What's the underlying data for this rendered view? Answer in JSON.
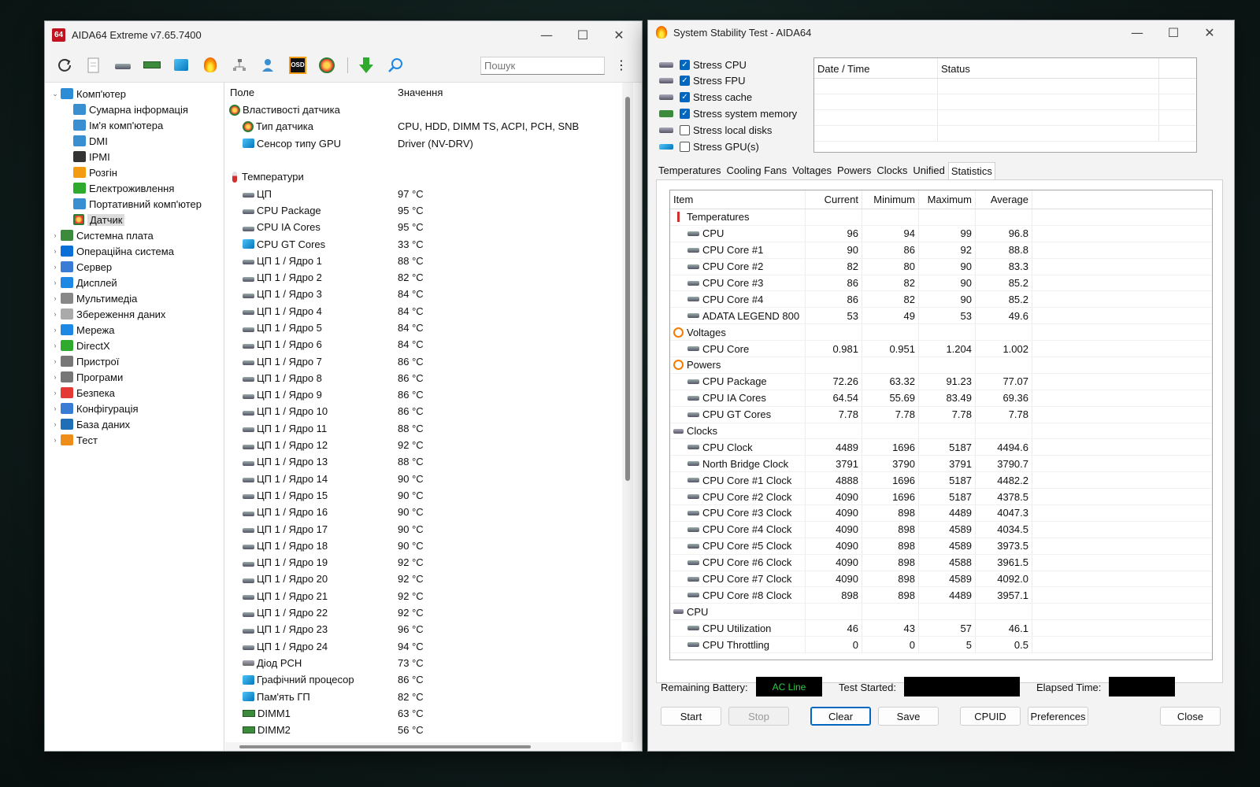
{
  "aida": {
    "title": "AIDA64 Extreme v7.65.7400",
    "badge": "64",
    "search_placeholder": "Пошук",
    "tree": [
      {
        "label": "Комп'ютер",
        "expanded": true,
        "icon": "computer-icon",
        "children": [
          {
            "label": "Сумарна інформація"
          },
          {
            "label": "Ім'я комп'ютера"
          },
          {
            "label": "DMI"
          },
          {
            "label": "IPMI"
          },
          {
            "label": "Розгін"
          },
          {
            "label": "Електроживлення"
          },
          {
            "label": "Портативний комп'ютер"
          },
          {
            "label": "Датчик",
            "selected": true
          }
        ]
      },
      {
        "label": "Системна плата"
      },
      {
        "label": "Операційна система"
      },
      {
        "label": "Сервер"
      },
      {
        "label": "Дисплей"
      },
      {
        "label": "Мультимедіа"
      },
      {
        "label": "Збереження даних"
      },
      {
        "label": "Мережа"
      },
      {
        "label": "DirectX"
      },
      {
        "label": "Пристрої"
      },
      {
        "label": "Програми"
      },
      {
        "label": "Безпека"
      },
      {
        "label": "Конфігурація"
      },
      {
        "label": "База даних"
      },
      {
        "label": "Тест"
      }
    ],
    "columns": {
      "field": "Поле",
      "value": "Значення"
    },
    "rows": [
      {
        "type": "group",
        "icon": "sensor",
        "field": "Властивості датчика",
        "value": ""
      },
      {
        "type": "item",
        "icon": "sensor",
        "field": "Тип датчика",
        "value": "CPU, HDD, DIMM TS, ACPI, PCH, SNB"
      },
      {
        "type": "item",
        "icon": "mon",
        "field": "Сенсор типу GPU",
        "value": "Driver  (NV-DRV)"
      },
      {
        "type": "blank",
        "field": "",
        "value": ""
      },
      {
        "type": "group",
        "icon": "therm",
        "field": "Температури",
        "value": ""
      },
      {
        "type": "item",
        "icon": "chip",
        "field": "ЦП",
        "value": "97 °C"
      },
      {
        "type": "item",
        "icon": "chip",
        "field": "CPU Package",
        "value": "95 °C"
      },
      {
        "type": "item",
        "icon": "chip",
        "field": "CPU IA Cores",
        "value": "95 °C"
      },
      {
        "type": "item",
        "icon": "mon",
        "field": "CPU GT Cores",
        "value": "33 °C"
      },
      {
        "type": "item",
        "icon": "chip",
        "field": "ЦП 1 / Ядро 1",
        "value": "88 °C"
      },
      {
        "type": "item",
        "icon": "chip",
        "field": "ЦП 1 / Ядро 2",
        "value": "82 °C"
      },
      {
        "type": "item",
        "icon": "chip",
        "field": "ЦП 1 / Ядро 3",
        "value": "84 °C"
      },
      {
        "type": "item",
        "icon": "chip",
        "field": "ЦП 1 / Ядро 4",
        "value": "84 °C"
      },
      {
        "type": "item",
        "icon": "chip",
        "field": "ЦП 1 / Ядро 5",
        "value": "84 °C"
      },
      {
        "type": "item",
        "icon": "chip",
        "field": "ЦП 1 / Ядро 6",
        "value": "84 °C"
      },
      {
        "type": "item",
        "icon": "chip",
        "field": "ЦП 1 / Ядро 7",
        "value": "86 °C"
      },
      {
        "type": "item",
        "icon": "chip",
        "field": "ЦП 1 / Ядро 8",
        "value": "86 °C"
      },
      {
        "type": "item",
        "icon": "chip",
        "field": "ЦП 1 / Ядро 9",
        "value": "86 °C"
      },
      {
        "type": "item",
        "icon": "chip",
        "field": "ЦП 1 / Ядро 10",
        "value": "86 °C"
      },
      {
        "type": "item",
        "icon": "chip",
        "field": "ЦП 1 / Ядро 11",
        "value": "88 °C"
      },
      {
        "type": "item",
        "icon": "chip",
        "field": "ЦП 1 / Ядро 12",
        "value": "92 °C"
      },
      {
        "type": "item",
        "icon": "chip",
        "field": "ЦП 1 / Ядро 13",
        "value": "88 °C"
      },
      {
        "type": "item",
        "icon": "chip",
        "field": "ЦП 1 / Ядро 14",
        "value": "90 °C"
      },
      {
        "type": "item",
        "icon": "chip",
        "field": "ЦП 1 / Ядро 15",
        "value": "90 °C"
      },
      {
        "type": "item",
        "icon": "chip",
        "field": "ЦП 1 / Ядро 16",
        "value": "90 °C"
      },
      {
        "type": "item",
        "icon": "chip",
        "field": "ЦП 1 / Ядро 17",
        "value": "90 °C"
      },
      {
        "type": "item",
        "icon": "chip",
        "field": "ЦП 1 / Ядро 18",
        "value": "90 °C"
      },
      {
        "type": "item",
        "icon": "chip",
        "field": "ЦП 1 / Ядро 19",
        "value": "92 °C"
      },
      {
        "type": "item",
        "icon": "chip",
        "field": "ЦП 1 / Ядро 20",
        "value": "92 °C"
      },
      {
        "type": "item",
        "icon": "chip",
        "field": "ЦП 1 / Ядро 21",
        "value": "92 °C"
      },
      {
        "type": "item",
        "icon": "chip",
        "field": "ЦП 1 / Ядро 22",
        "value": "92 °C"
      },
      {
        "type": "item",
        "icon": "chip",
        "field": "ЦП 1 / Ядро 23",
        "value": "96 °C"
      },
      {
        "type": "item",
        "icon": "chip",
        "field": "ЦП 1 / Ядро 24",
        "value": "94 °C"
      },
      {
        "type": "item",
        "icon": "hdd",
        "field": "Діод PCH",
        "value": "73 °C"
      },
      {
        "type": "item",
        "icon": "mon",
        "field": "Графічний процесор",
        "value": "86 °C"
      },
      {
        "type": "item",
        "icon": "mon",
        "field": "Пам'ять ГП",
        "value": "82 °C"
      },
      {
        "type": "item",
        "icon": "ram",
        "field": "DIMM1",
        "value": "63 °C"
      },
      {
        "type": "item",
        "icon": "ram",
        "field": "DIMM2",
        "value": "56 °C"
      }
    ]
  },
  "sst": {
    "title": "System Stability Test - AIDA64",
    "stress": [
      {
        "label": "Stress CPU",
        "checked": true
      },
      {
        "label": "Stress FPU",
        "checked": true
      },
      {
        "label": "Stress cache",
        "checked": true
      },
      {
        "label": "Stress system memory",
        "checked": true
      },
      {
        "label": "Stress local disks",
        "checked": false
      },
      {
        "label": "Stress GPU(s)",
        "checked": false
      }
    ],
    "log_columns": {
      "datetime": "Date / Time",
      "status": "Status"
    },
    "tabs": [
      "Temperatures",
      "Cooling Fans",
      "Voltages",
      "Powers",
      "Clocks",
      "Unified",
      "Statistics"
    ],
    "active_tab": "Statistics",
    "stat_columns": {
      "item": "Item",
      "current": "Current",
      "minimum": "Minimum",
      "maximum": "Maximum",
      "average": "Average"
    },
    "stats": [
      {
        "type": "group",
        "icon": "therm",
        "item": "Temperatures"
      },
      {
        "type": "row",
        "item": "CPU",
        "current": "96",
        "minimum": "94",
        "maximum": "99",
        "average": "96.8"
      },
      {
        "type": "row",
        "item": "CPU Core #1",
        "current": "90",
        "minimum": "86",
        "maximum": "92",
        "average": "88.8"
      },
      {
        "type": "row",
        "item": "CPU Core #2",
        "current": "82",
        "minimum": "80",
        "maximum": "90",
        "average": "83.3"
      },
      {
        "type": "row",
        "item": "CPU Core #3",
        "current": "86",
        "minimum": "82",
        "maximum": "90",
        "average": "85.2"
      },
      {
        "type": "row",
        "item": "CPU Core #4",
        "current": "86",
        "minimum": "82",
        "maximum": "90",
        "average": "85.2"
      },
      {
        "type": "row",
        "item": "ADATA LEGEND 800",
        "current": "53",
        "minimum": "49",
        "maximum": "53",
        "average": "49.6"
      },
      {
        "type": "group",
        "icon": "bolt",
        "item": "Voltages"
      },
      {
        "type": "row",
        "item": "CPU Core",
        "current": "0.981",
        "minimum": "0.951",
        "maximum": "1.204",
        "average": "1.002"
      },
      {
        "type": "group",
        "icon": "bolt",
        "item": "Powers"
      },
      {
        "type": "row",
        "item": "CPU Package",
        "current": "72.26",
        "minimum": "63.32",
        "maximum": "91.23",
        "average": "77.07"
      },
      {
        "type": "row",
        "item": "CPU IA Cores",
        "current": "64.54",
        "minimum": "55.69",
        "maximum": "83.49",
        "average": "69.36"
      },
      {
        "type": "row",
        "item": "CPU GT Cores",
        "current": "7.78",
        "minimum": "7.78",
        "maximum": "7.78",
        "average": "7.78"
      },
      {
        "type": "group",
        "icon": "chip",
        "item": "Clocks"
      },
      {
        "type": "row",
        "item": "CPU Clock",
        "current": "4489",
        "minimum": "1696",
        "maximum": "5187",
        "average": "4494.6"
      },
      {
        "type": "row",
        "item": "North Bridge Clock",
        "current": "3791",
        "minimum": "3790",
        "maximum": "3791",
        "average": "3790.7"
      },
      {
        "type": "row",
        "item": "CPU Core #1 Clock",
        "current": "4888",
        "minimum": "1696",
        "maximum": "5187",
        "average": "4482.2"
      },
      {
        "type": "row",
        "item": "CPU Core #2 Clock",
        "current": "4090",
        "minimum": "1696",
        "maximum": "5187",
        "average": "4378.5"
      },
      {
        "type": "row",
        "item": "CPU Core #3 Clock",
        "current": "4090",
        "minimum": "898",
        "maximum": "4489",
        "average": "4047.3"
      },
      {
        "type": "row",
        "item": "CPU Core #4 Clock",
        "current": "4090",
        "minimum": "898",
        "maximum": "4589",
        "average": "4034.5"
      },
      {
        "type": "row",
        "item": "CPU Core #5 Clock",
        "current": "4090",
        "minimum": "898",
        "maximum": "4589",
        "average": "3973.5"
      },
      {
        "type": "row",
        "item": "CPU Core #6 Clock",
        "current": "4090",
        "minimum": "898",
        "maximum": "4588",
        "average": "3961.5"
      },
      {
        "type": "row",
        "item": "CPU Core #7 Clock",
        "current": "4090",
        "minimum": "898",
        "maximum": "4589",
        "average": "4092.0"
      },
      {
        "type": "row",
        "item": "CPU Core #8 Clock",
        "current": "898",
        "minimum": "898",
        "maximum": "4489",
        "average": "3957.1"
      },
      {
        "type": "group",
        "icon": "chip",
        "item": "CPU"
      },
      {
        "type": "row",
        "item": "CPU Utilization",
        "current": "46",
        "minimum": "43",
        "maximum": "57",
        "average": "46.1"
      },
      {
        "type": "row",
        "item": "CPU Throttling",
        "current": "0",
        "minimum": "0",
        "maximum": "5",
        "average": "0.5"
      }
    ],
    "remaining_battery_label": "Remaining Battery:",
    "remaining_battery_value": "AC Line",
    "test_started_label": "Test Started:",
    "elapsed_label": "Elapsed Time:",
    "buttons": {
      "start": "Start",
      "stop": "Stop",
      "clear": "Clear",
      "save": "Save",
      "cpuid": "CPUID",
      "preferences": "Preferences",
      "close": "Close"
    }
  }
}
